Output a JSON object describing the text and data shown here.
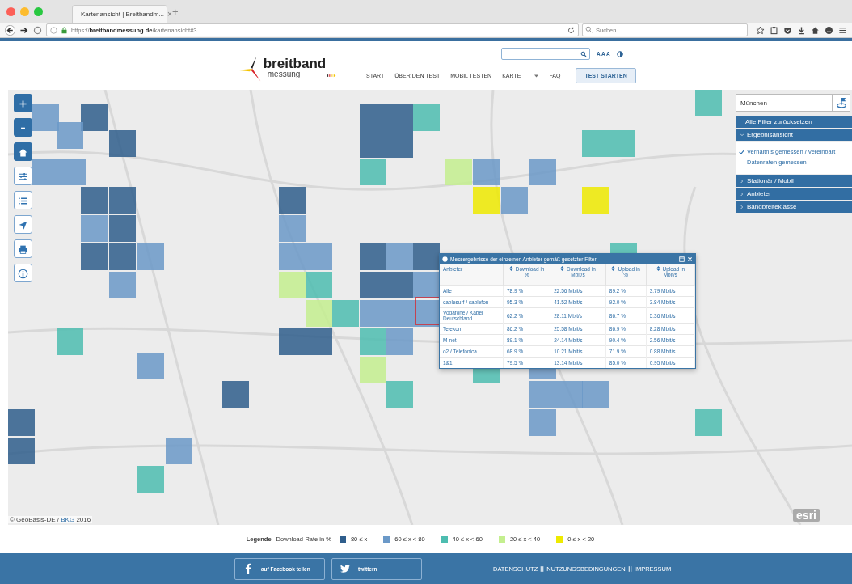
{
  "browser": {
    "tab": {
      "title": "Kartenansicht | Breitbandm...",
      "close": "×",
      "new_tab": "+"
    },
    "address": "https://**breitbandmessung.de**/kartenansicht#3",
    "search": {
      "placeholder": "Suchen"
    }
  },
  "header": {
    "logo": {
      "line_1": "breitband",
      "line_2": "messung"
    },
    "font_size_toggle": "A A A",
    "nav": [
      {
        "label": "START",
        "dropdown": false
      },
      {
        "label": "ÜBER DEN TEST",
        "dropdown": false
      },
      {
        "label": "MOBIL TESTEN",
        "dropdown": false
      },
      {
        "label": "KARTE",
        "dropdown": true
      },
      {
        "label": "FAQ",
        "dropdown": false
      }
    ],
    "cta": "TEST STARTEN"
  },
  "map": {
    "attribution": {
      "prefix": "© GeoBasis-DE / ",
      "link": "BKG",
      "suffix": " 2016"
    },
    "logo": "esri",
    "location_search": {
      "value": "München"
    },
    "filter_panel": {
      "reset": "Alle Filter zurücksetzen",
      "sections": [
        {
          "label": "Ergebnisansicht",
          "expanded": true,
          "options": [
            {
              "label": "Verhältnis gemessen / vereinbart",
              "selected": true
            },
            {
              "label": "Datenraten gemessen",
              "selected": false
            }
          ]
        },
        {
          "label": "Stationär / Mobil",
          "expanded": false
        },
        {
          "label": "Anbieter",
          "expanded": false
        },
        {
          "label": "Bandbreiteklasse",
          "expanded": false
        }
      ]
    },
    "popup": {
      "title": "Messergebnisse der einzelnen Anbieter gemäß gesetzter Filter",
      "columns": [
        {
          "label": "Anbieter",
          "sortable": false
        },
        {
          "label": "Download in %",
          "sortable": true
        },
        {
          "label": "Download in Mbit/s",
          "sortable": true
        },
        {
          "label": "Upload in %",
          "sortable": true
        },
        {
          "label": "Upload in Mbit/s",
          "sortable": true
        }
      ],
      "rows": [
        [
          "Alle",
          "78.9 %",
          "22.56 Mbit/s",
          "89.2 %",
          "3.79 Mbit/s"
        ],
        [
          "cablesurf / cablefon",
          "95.3 %",
          "41.52 Mbit/s",
          "92.0 %",
          "3.84 Mbit/s"
        ],
        [
          "Vodafone / Kabel Deutschland",
          "62.2 %",
          "28.11 Mbit/s",
          "86.7 %",
          "5.36 Mbit/s"
        ],
        [
          "Telekom",
          "86.2 %",
          "25.58 Mbit/s",
          "86.9 %",
          "8.28 Mbit/s"
        ],
        [
          "M-net",
          "89.1 %",
          "24.14 Mbit/s",
          "90.4 %",
          "2.56 Mbit/s"
        ],
        [
          "o2 / Telefonica",
          "68.9 %",
          "10.21 Mbit/s",
          "71.9 %",
          "0.88 Mbit/s"
        ],
        [
          "1&1",
          "79.5 %",
          "13.14 Mbit/s",
          "85.0 %",
          "0.95 Mbit/s"
        ]
      ]
    }
  },
  "legend": {
    "title": "Legende",
    "subtitle": "Download-Rate in %",
    "items": [
      {
        "label": "80 ≤ x",
        "color": "#2f5e8c"
      },
      {
        "label": "60 ≤ x < 80",
        "color": "#6b99c8"
      },
      {
        "label": "40 ≤ x < 60",
        "color": "#4dbdb0"
      },
      {
        "label": "20 ≤ x < 40",
        "color": "#c4ef8f"
      },
      {
        "label": "0 ≤ x < 20",
        "color": "#eeea00"
      }
    ]
  },
  "footer": {
    "share": [
      {
        "kind": "facebook",
        "label": "auf Facebook teilen"
      },
      {
        "kind": "twitter",
        "label": "twittern"
      }
    ],
    "links": [
      "DATENSCHUTZ",
      "NUTZUNGSBEDINGUNGEN",
      "IMPRESSUM"
    ]
  }
}
